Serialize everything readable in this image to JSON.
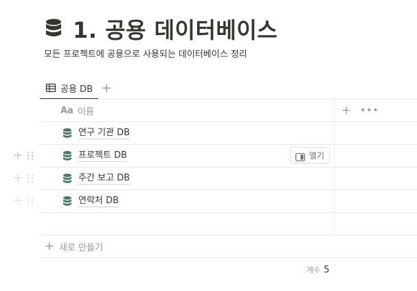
{
  "page": {
    "title": "1. 공용 데이터베이스",
    "title_icon": "database-icon",
    "description": "모든 프로젝트에 공용으로 사용되는 데이터베이스 정리"
  },
  "views": {
    "tabs": [
      {
        "label": "공용 DB",
        "icon": "table-icon",
        "active": true
      }
    ],
    "add_view_label": "+"
  },
  "table": {
    "columns": [
      {
        "type_label": "Aa",
        "label": "이름"
      }
    ],
    "add_column_label": "+",
    "more_label": "•••",
    "rows": [
      {
        "title": "연구 기관 DB",
        "icon": "database-icon"
      },
      {
        "title": "프로젝트 DB",
        "icon": "database-icon"
      },
      {
        "title": "주간 보고 DB",
        "icon": "database-icon"
      },
      {
        "title": "연락처 DB",
        "icon": "database-icon"
      }
    ],
    "hovered_row": {
      "open_label": "열기"
    },
    "new_row_label": "새로 만들기",
    "row_add_label": "+",
    "footer": {
      "count_label": "개수",
      "count_value": "5"
    }
  },
  "colors": {
    "text": "#37352f",
    "muted": "#9b9a97",
    "border": "#e9e9e7",
    "db_icon": "#4a7a62"
  }
}
